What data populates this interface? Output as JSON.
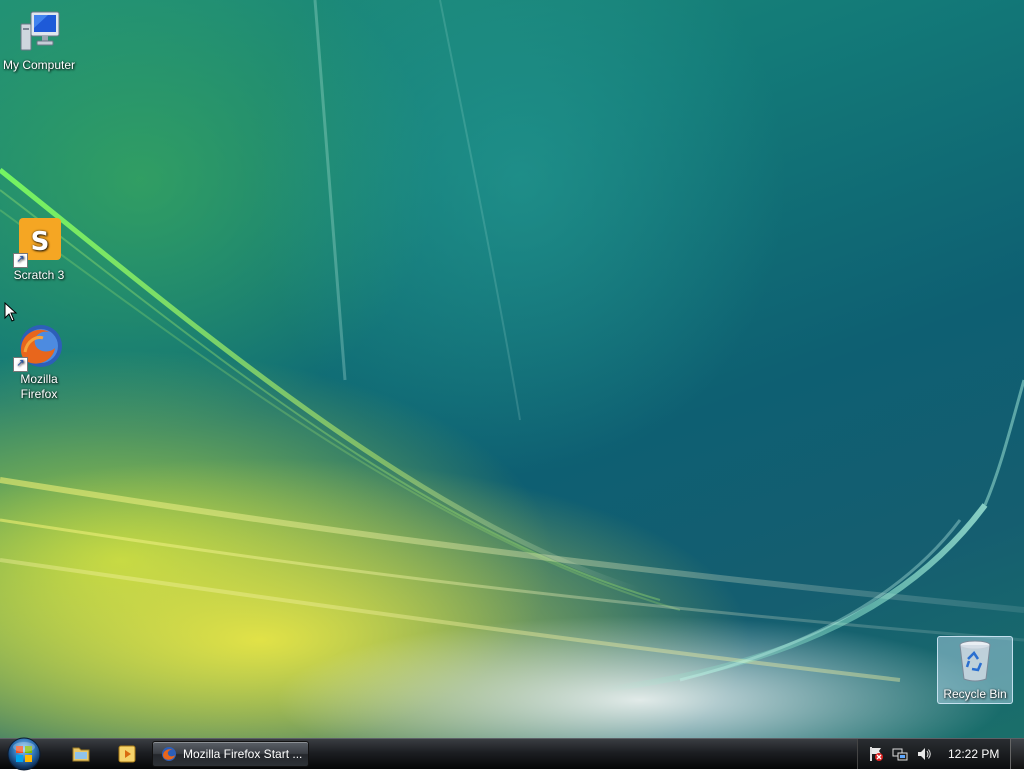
{
  "desktop": {
    "icons": [
      {
        "label": "My Computer",
        "icon": "computer-icon"
      },
      {
        "label": "Scratch 3",
        "icon": "scratch-icon",
        "shortcut": true
      },
      {
        "label": "Mozilla Firefox",
        "icon": "firefox-icon",
        "shortcut": true
      },
      {
        "label": "Recycle Bin",
        "icon": "recycle-bin-icon",
        "selected": true
      }
    ]
  },
  "taskbar": {
    "start_icon": "windows-start-orb",
    "quick_launch": [
      {
        "icon": "explorer-folder-icon"
      },
      {
        "icon": "media-player-icon"
      }
    ],
    "tasks": [
      {
        "label": "Mozilla Firefox Start ...",
        "icon": "firefox-icon"
      }
    ],
    "tray": {
      "icons": [
        "security-alert-icon",
        "network-icon",
        "volume-icon"
      ],
      "clock": "12:22 PM"
    }
  },
  "colors": {
    "taskbar": "#1c1e22",
    "wallpaper_teal": "#137a78",
    "wallpaper_yellow": "#e8e646",
    "wallpaper_green": "#3cab5a"
  }
}
